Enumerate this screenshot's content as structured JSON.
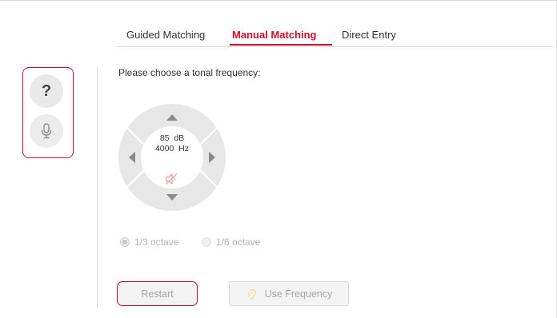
{
  "tabs": [
    {
      "label": "Guided Matching",
      "active": false
    },
    {
      "label": "Manual Matching",
      "active": true
    },
    {
      "label": "Direct Entry",
      "active": false
    }
  ],
  "left_panel": {
    "help_icon": "question-mark-icon",
    "mic_icon": "microphone-icon",
    "help_glyph": "?"
  },
  "main": {
    "prompt": "Please choose a tonal frequency:",
    "dial": {
      "level_value": "85",
      "level_unit": "dB",
      "freq_value": "4000",
      "freq_unit": "Hz",
      "mute_icon": "speaker-muted-icon",
      "arrow_icons": [
        "arrow-up-icon",
        "arrow-down-icon",
        "arrow-left-icon",
        "arrow-right-icon"
      ]
    },
    "octave_options": [
      {
        "label": "1/3 octave",
        "selected": true
      },
      {
        "label": "1/6 octave",
        "selected": false
      }
    ],
    "buttons": {
      "restart": "Restart",
      "use_frequency": "Use Frequency",
      "use_frequency_icon": "ear-icon"
    }
  },
  "colors": {
    "accent": "#d0102a",
    "dial_ring": "#e7e7e7",
    "disabled_text": "#a8a8a8"
  }
}
